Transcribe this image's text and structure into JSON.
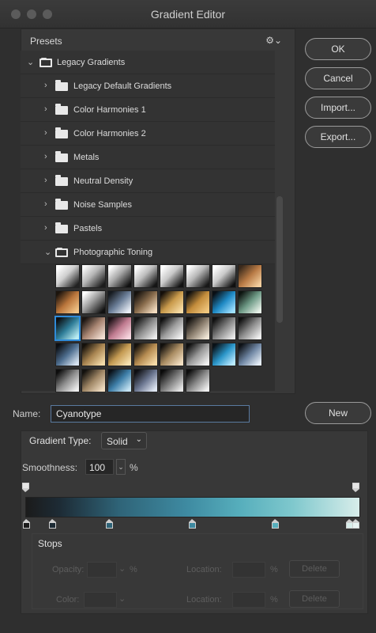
{
  "window": {
    "title": "Gradient Editor"
  },
  "presets": {
    "label": "Presets",
    "gear_icon": "gear-icon",
    "tree": [
      {
        "label": "Legacy Gradients",
        "expanded": true,
        "level": 0
      },
      {
        "label": "Legacy Default Gradients",
        "expanded": false,
        "level": 1
      },
      {
        "label": "Color Harmonies 1",
        "expanded": false,
        "level": 1
      },
      {
        "label": "Color Harmonies 2",
        "expanded": false,
        "level": 1
      },
      {
        "label": "Metals",
        "expanded": false,
        "level": 1
      },
      {
        "label": "Neutral Density",
        "expanded": false,
        "level": 1
      },
      {
        "label": "Noise Samples",
        "expanded": false,
        "level": 1
      },
      {
        "label": "Pastels",
        "expanded": false,
        "level": 1
      },
      {
        "label": "Photographic Toning",
        "expanded": true,
        "level": 1
      }
    ],
    "selected_swatch_index": 16
  },
  "buttons": {
    "ok": "OK",
    "cancel": "Cancel",
    "import": "Import...",
    "export": "Export...",
    "new": "New"
  },
  "name": {
    "label": "Name:",
    "value": "Cyanotype"
  },
  "gradient": {
    "type_label": "Gradient Type:",
    "type_value": "Solid",
    "smoothness_label": "Smoothness:",
    "smoothness_value": "100",
    "smoothness_unit": "%"
  },
  "stops": {
    "title": "Stops",
    "opacity_label": "Opacity:",
    "opacity_unit": "%",
    "location_label": "Location:",
    "location_unit": "%",
    "color_label": "Color:",
    "delete_label": "Delete"
  },
  "colors": {
    "accent": "#2f8bd8",
    "gradient_start": "#1b1b1b",
    "gradient_mid": "#3e8aa1",
    "gradient_end": "#d8edea"
  }
}
